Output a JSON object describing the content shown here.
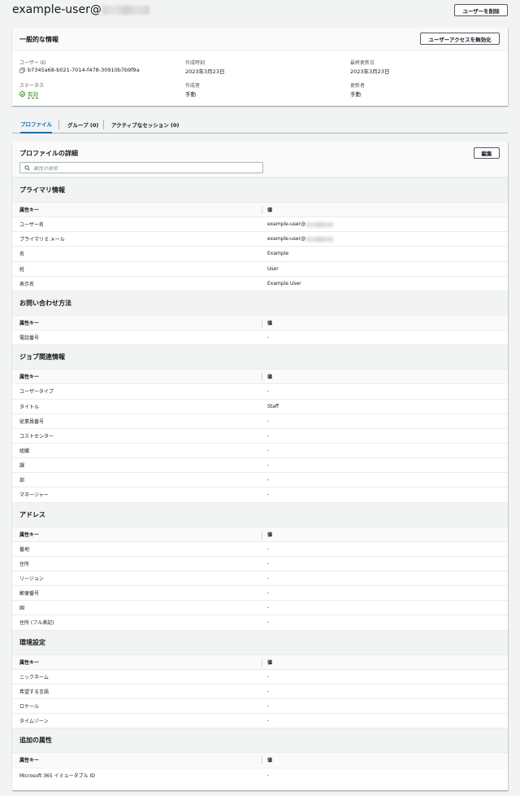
{
  "header": {
    "title": "example-user@",
    "delete_button": "ユーザーを削除"
  },
  "general": {
    "title": "一般的な情報",
    "disable_button": "ユーザーアクセスを無効化",
    "user_id_label": "ユーザー ID",
    "user_id": "b7345a68-b021-7014-f478-30910b7b9f9a",
    "created_label": "作成時刻",
    "created_value": "2023年3月23日",
    "updated_label": "最終更新日",
    "updated_value": "2023年3月23日",
    "status_label": "ステータス",
    "status_value": "有効",
    "creator_label": "作成者",
    "creator_value": "手動",
    "updater_label": "更新者",
    "updater_value": "手動"
  },
  "tabs": [
    {
      "label": "プロファイル"
    },
    {
      "label": "グループ (0)"
    },
    {
      "label": "アクティブなセッション (0)"
    }
  ],
  "profile": {
    "title": "プロファイルの詳細",
    "edit_button": "編集",
    "search_placeholder": "属性の検索",
    "sections": [
      {
        "title": "プライマリ情報",
        "key_header": "属性キー",
        "value_header": "値",
        "rows": [
          {
            "key": "ユーザー名",
            "value": "example-user@"
          },
          {
            "key": "プライマリ E メール",
            "value": "example-user@"
          },
          {
            "key": "名",
            "value": "Example"
          },
          {
            "key": "姓",
            "value": "User"
          },
          {
            "key": "表示名",
            "value": "Example User"
          }
        ]
      },
      {
        "title": "お問い合わせ方法",
        "key_header": "属性キー",
        "value_header": "値",
        "rows": [
          {
            "key": "電話番号",
            "value": "-"
          }
        ]
      },
      {
        "title": "ジョブ関連情報",
        "key_header": "属性キー",
        "value_header": "値",
        "rows": [
          {
            "key": "ユーザータイプ",
            "value": "-"
          },
          {
            "key": "タイトル",
            "value": "Staff"
          },
          {
            "key": "従業員番号",
            "value": "-"
          },
          {
            "key": "コストセンター",
            "value": "-"
          },
          {
            "key": "組織",
            "value": "-"
          },
          {
            "key": "課",
            "value": "-"
          },
          {
            "key": "部",
            "value": "-"
          },
          {
            "key": "マネージャー",
            "value": "-"
          }
        ]
      },
      {
        "title": "アドレス",
        "key_header": "属性キー",
        "value_header": "値",
        "rows": [
          {
            "key": "番地",
            "value": "-"
          },
          {
            "key": "住所",
            "value": "-"
          },
          {
            "key": "リージョン",
            "value": "-"
          },
          {
            "key": "郵便番号",
            "value": "-"
          },
          {
            "key": "国",
            "value": "-"
          },
          {
            "key": "住所 (フル表記)",
            "value": "-"
          }
        ]
      },
      {
        "title": "環境設定",
        "key_header": "属性キー",
        "value_header": "値",
        "rows": [
          {
            "key": "ニックネーム",
            "value": "-"
          },
          {
            "key": "希望する言語",
            "value": "-"
          },
          {
            "key": "ロケール",
            "value": "-"
          },
          {
            "key": "タイムゾーン",
            "value": "-"
          }
        ]
      },
      {
        "title": "追加の属性",
        "key_header": "属性キー",
        "value_header": "値",
        "rows": [
          {
            "key": "Microsoft 365 イミュータブル ID",
            "value": "-"
          }
        ]
      }
    ]
  }
}
